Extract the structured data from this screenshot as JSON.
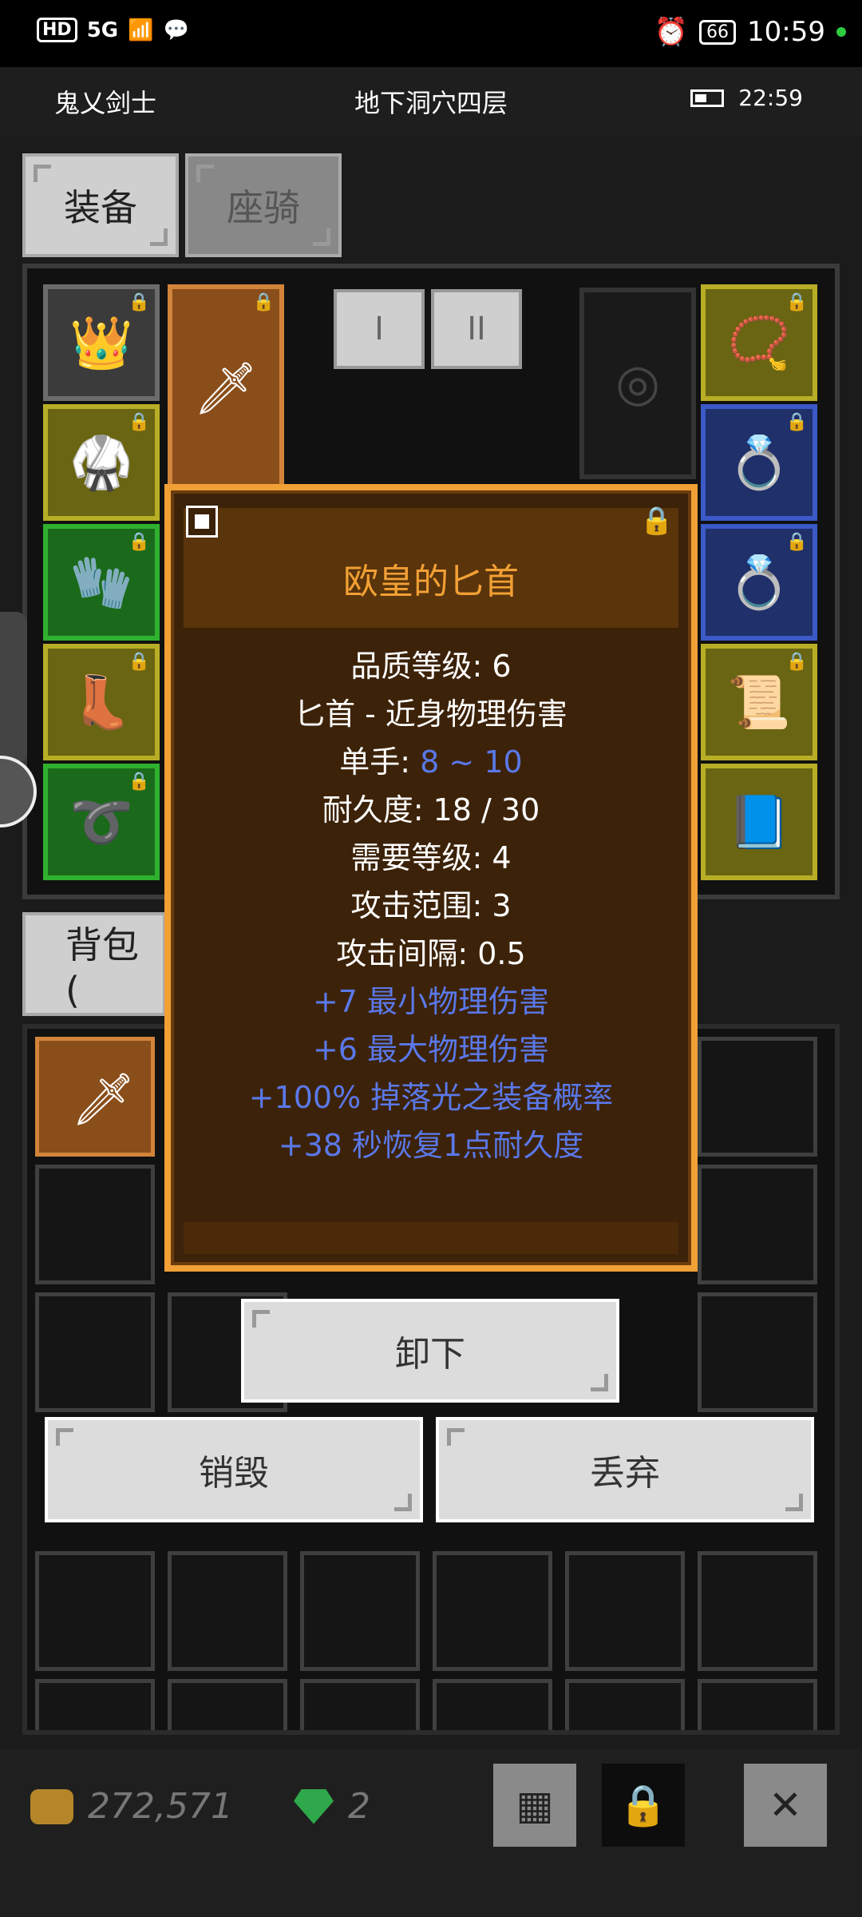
{
  "status_bar": {
    "network": "HD",
    "signal": "5G",
    "battery": "66",
    "time": "10:59"
  },
  "header": {
    "character": "鬼乂剑士",
    "location": "地下洞穴四层",
    "game_time": "22:59"
  },
  "tabs": {
    "equipment": "装备",
    "mount": "座骑"
  },
  "equip_sets": {
    "set1": "I",
    "set2": "II"
  },
  "bag_tab": "背包 (",
  "dialog": {
    "title": "欧皇的匕首",
    "quality": "品质等级: 6",
    "type": "匕首 - 近身物理伤害",
    "hand_label": "单手: ",
    "hand_value": "8 ~ 10",
    "durability": "耐久度: 18 / 30",
    "required_level": "需要等级: 4",
    "attack_range": "攻击范围: 3",
    "attack_interval": "攻击间隔: 0.5",
    "affixes": [
      "+7 最小物理伤害",
      "+6 最大物理伤害",
      "+100% 掉落光之装备概率",
      "+38 秒恢复1点耐久度"
    ]
  },
  "actions": {
    "unequip": "卸下",
    "destroy": "销毁",
    "discard": "丢弃"
  },
  "currency": {
    "gold": "272,571",
    "gems": "2"
  },
  "icons": {
    "grid": "grid-icon",
    "lock": "lock-icon",
    "close": "close-icon"
  }
}
